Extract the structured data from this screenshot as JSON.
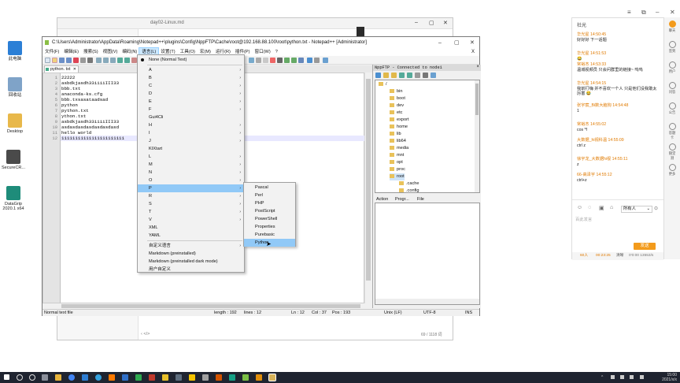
{
  "desktop": {
    "icons": [
      {
        "label": "此电脑",
        "color": "#2b7fd6"
      },
      {
        "label": "回收站",
        "color": "#7fa3c8"
      },
      {
        "label": "Desktop",
        "color": "#e8b84a"
      },
      {
        "label": "SecureCR...",
        "color": "#4a4a4a"
      },
      {
        "label": "DataGrip 2020.1 x64",
        "color": "#1e8c7a"
      }
    ]
  },
  "typora": {
    "tab_files": "文件",
    "tab_outline": "大纲",
    "doc_title": "day02-Linux.md",
    "footer_counter": "69 / 1118 词",
    "footer_left": "‹  </>"
  },
  "npp": {
    "title": "C:\\Users\\Administrator\\AppData\\Roaming\\Notepad++\\plugins\\Config\\NppFTP\\Cache\\root@192.168.88.100\\root\\python.txt - Notepad++ [Administrator]",
    "menu": [
      "文件(F)",
      "编辑(E)",
      "搜索(S)",
      "视图(V)",
      "编码(N)",
      "语言(L)",
      "设置(T)",
      "工具(O)",
      "宏(M)",
      "运行(R)",
      "插件(P)",
      "窗口(W)",
      "?"
    ],
    "active_menu_index": 5,
    "file_tab": "python. txt",
    "lines": [
      "22222",
      "asbdkjasdh33iiiiIII33",
      "bbb.txt",
      "anaconda-ks.cfg",
      "bbb.txsasataadsad",
      "python",
      "python.txt",
      "ython.txt",
      "asbdkjasdh33iiiiIII33",
      "asdasdasdasdasdasdasd",
      "hello world",
      "11111111111111111111111"
    ],
    "status": {
      "type": "Normal text file",
      "length": "length : 192",
      "lines": "lines : 12",
      "ln": "Ln : 12",
      "col": "Col : 37",
      "pos": "Pos : 193",
      "eol": "Unix (LF)",
      "enc": "UTF-8",
      "ins": "INS"
    }
  },
  "ftp": {
    "header": "NppFTP - Connected to node1",
    "tree": [
      "/",
      "bin",
      "boot",
      "dev",
      "etc",
      "export",
      "home",
      "lib",
      "lib64",
      "media",
      "mnt",
      "opt",
      "proc",
      "root",
      ".cache",
      ".config"
    ],
    "queue_cols": [
      "Action",
      "Progr...",
      "File"
    ]
  },
  "language_menu": {
    "items": [
      {
        "label": "None (Normal Text)",
        "selected": true
      },
      {
        "label": "A",
        "sub": true
      },
      {
        "label": "B",
        "sub": true
      },
      {
        "label": "C",
        "sub": true
      },
      {
        "label": "D",
        "sub": true
      },
      {
        "label": "E",
        "sub": true
      },
      {
        "label": "F",
        "sub": true
      },
      {
        "label": "Gui4Cli",
        "sub": false
      },
      {
        "label": "H",
        "sub": true
      },
      {
        "label": "I",
        "sub": true
      },
      {
        "label": "J",
        "sub": true
      },
      {
        "label": "KIXtart",
        "sub": false
      },
      {
        "label": "L",
        "sub": true
      },
      {
        "label": "M",
        "sub": true
      },
      {
        "label": "N",
        "sub": true
      },
      {
        "label": "O",
        "sub": true
      },
      {
        "label": "P",
        "sub": true,
        "highlight": true
      },
      {
        "label": "R",
        "sub": true
      },
      {
        "label": "S",
        "sub": true
      },
      {
        "label": "T",
        "sub": true
      },
      {
        "label": "V",
        "sub": true
      },
      {
        "label": "XML",
        "sub": false
      },
      {
        "label": "YAML",
        "sub": false
      },
      {
        "label": "自定义语言",
        "sub": true,
        "sep_before": true
      },
      {
        "label": "Markdown (preinstalled)",
        "sub": false
      },
      {
        "label": "Markdown (preinstalled dark mode)",
        "sub": false
      },
      {
        "label": "用户自定义",
        "sub": false
      }
    ]
  },
  "p_submenu": {
    "items": [
      "Pascal",
      "Perl",
      "PHP",
      "PostScript",
      "PowerShell",
      "Properties",
      "Purebasic",
      "Python"
    ],
    "highlight_index": 7
  },
  "chat": {
    "title": "社光",
    "messages": [
      {
        "name": "华光星 14:50:45",
        "text": "好好好 下一话题"
      },
      {
        "name": "华光星 14:51:53",
        "text": "😂"
      },
      {
        "name": "常裕杰 14:53:33",
        "text": "温城视频员 只会问群里的链接~ 呜呜"
      },
      {
        "name": "华光星 14:54:15",
        "text": "我前打嗨    并不喜欢一个人  只是他们没我敢太厉害 😂"
      },
      {
        "name": "张宇宸_Bi数大脑狗 14:54:48",
        "text": "1"
      },
      {
        "name": "常裕杰 14:55:02",
        "text": "cos  *f"
      },
      {
        "name": "大数据_hi视科温 14:55:09",
        "text": "ctrl  z"
      },
      {
        "name": "徐宇龙_大数据hi视 14:55:11",
        "text": "z"
      },
      {
        "name": "66-高泽宇 14:55:12",
        "text": "ctrl+z"
      }
    ],
    "audience_label": "所有人",
    "input_placeholder": "百此发言",
    "send_label": "发送",
    "footer": {
      "count": "60人",
      "time": "00:23:25",
      "state": "清晰",
      "stats": "0'0:00 13553/s"
    }
  },
  "rail": [
    "聊天",
    "签到",
    "用户",
    "问答",
    "公告",
    "答题卡",
    "随堂测",
    "更多"
  ],
  "taskbar": {
    "time": "15:00",
    "date": "2021/x/x"
  }
}
